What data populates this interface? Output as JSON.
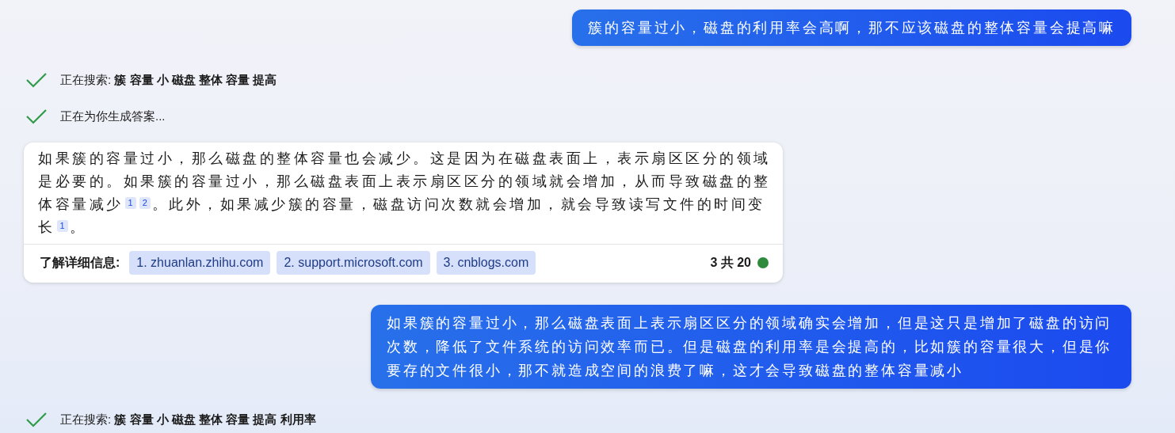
{
  "messages": [
    {
      "kind": "user",
      "text": "簇的容量过小，磁盘的利用率会高啊，那不应该磁盘的整体容量会提高嘛"
    },
    {
      "kind": "step",
      "done": true,
      "label": "正在搜索: ",
      "query": "簇 容量 小 磁盘 整体 容量 提高"
    },
    {
      "kind": "step",
      "done": true,
      "label": "正在为你生成答案..."
    },
    {
      "kind": "answer",
      "segments": [
        {
          "kind": "text",
          "text": "如果簇的容量过小，那么磁盘的整体容量也会减少。这是因为在磁盘表面上，表示扇区区分的领域是必要的。如果簇的容量过小，那么磁盘表面上表示扇区区分的领域就会增加，从而导致磁盘的整体容量减少"
        },
        {
          "kind": "cite",
          "text": "1"
        },
        {
          "kind": "cite",
          "text": "2"
        },
        {
          "kind": "text",
          "text": "。此外，如果减少簇的容量，磁盘访问次数就会增加，就会导致读写文件的时间变长"
        },
        {
          "kind": "cite",
          "text": "1"
        },
        {
          "kind": "text",
          "text": "。"
        }
      ],
      "learn_more": "了解详细信息:",
      "sources": [
        "1. zhuanlan.zhihu.com",
        "2. support.microsoft.com",
        "3. cnblogs.com"
      ],
      "counter": {
        "text": "3 共 20",
        "color": "#2e8b3e"
      }
    },
    {
      "kind": "user",
      "text": "如果簇的容量过小，那么磁盘表面上表示扇区区分的领域确实会增加，但是这只是增加了磁盘的访问次数，降低了文件系统的访问效率而已。但是磁盘的利用率是会提高的，比如簇的容量很大，但是你要存的文件很小，那不就造成空间的浪费了嘛，这才会导致磁盘的整体容量减小"
    },
    {
      "kind": "step",
      "done": true,
      "label": "正在搜索: ",
      "query": "簇 容量 小 磁盘 整体 容量 提高 利用率"
    }
  ]
}
